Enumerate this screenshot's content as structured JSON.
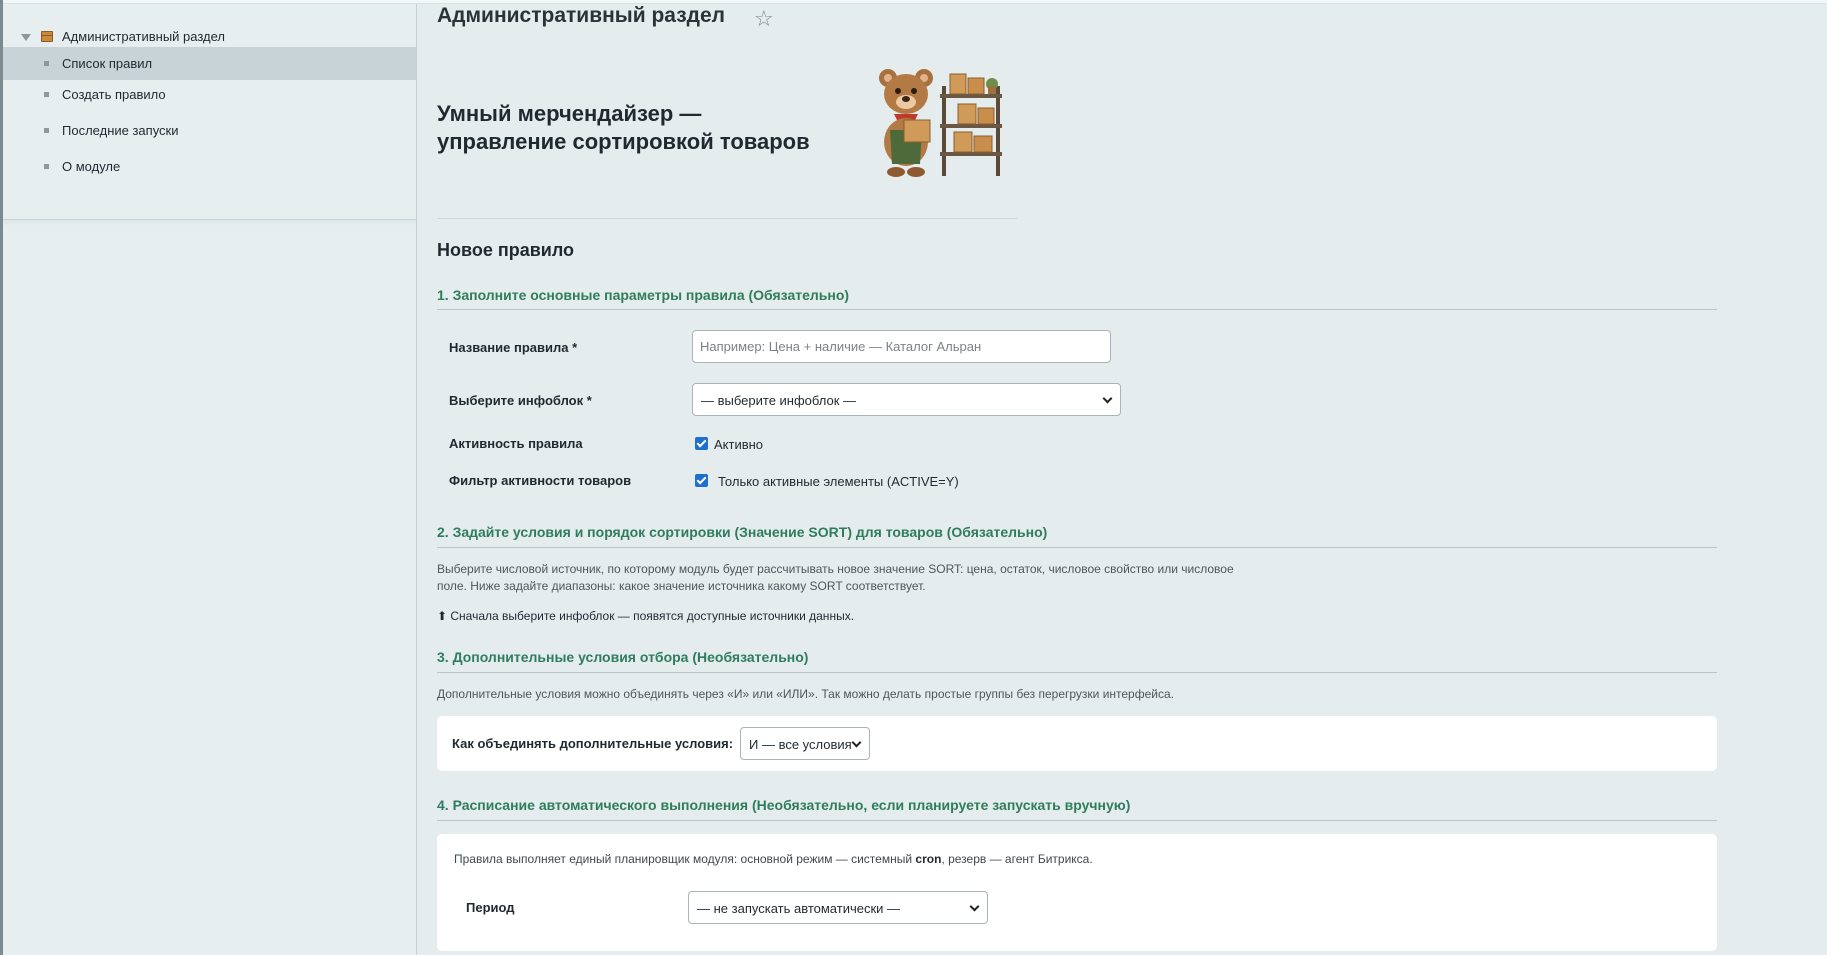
{
  "sidebar": {
    "root_label": "Административный раздел",
    "items": [
      {
        "label": "Список правил",
        "active": true
      },
      {
        "label": "Создать правило",
        "active": false
      },
      {
        "label": "Последние запуски",
        "active": false
      },
      {
        "label": "О модуле",
        "active": false
      }
    ]
  },
  "header": {
    "title": "Административный раздел",
    "hero_title_line1": "Умный мерчендайзер —",
    "hero_title_line2": "управление сортировкой товаров"
  },
  "form": {
    "heading": "Новое правило",
    "section1": {
      "title": "1. Заполните основные параметры правила (Обязательно)",
      "rule_name_label": "Название правила *",
      "rule_name_placeholder": "Например: Цена + наличие — Каталог Альран",
      "rule_name_value": "",
      "iblock_label": "Выберите инфоблок *",
      "iblock_selected": "— выберите инфоблок —",
      "activity_label": "Активность правила",
      "activity_checkbox_label": "Активно",
      "activity_checked": true,
      "filter_label": "Фильтр активности товаров",
      "filter_checkbox_label": "Только активные элементы (ACTIVE=Y)",
      "filter_checked": true
    },
    "section2": {
      "title": "2. Задайте условия и порядок сортировки (Значение SORT) для товаров (Обязательно)",
      "help_line1": "Выберите числовой источник, по которому модуль будет рассчитывать новое значение SORT: цена, остаток, числовое свойство или числовое",
      "help_line2": "поле. Ниже задайте диапазоны: какое значение источника какому SORT соответствует.",
      "note": "⬆ Сначала выберите инфоблок — появятся доступные источники данных."
    },
    "section3": {
      "title": "3. Дополнительные условия отбора (Необязательно)",
      "help": "Дополнительные условия можно объединять через «И» или «ИЛИ». Так можно делать простые группы без перегрузки интерфейса.",
      "combine_label": "Как объединять дополнительные условия:",
      "combine_selected": "И — все условия"
    },
    "section4": {
      "title": "4. Расписание автоматического выполнения (Необязательно, если планируете запускать вручную)",
      "info_prefix": "Правила выполняет единый планировщик модуля: основной режим — системный ",
      "info_cron": "cron",
      "info_suffix": ", резерв — агент Битрикса.",
      "period_label": "Период",
      "period_selected": "— не запускать автоматически —"
    }
  },
  "colors": {
    "section_title": "#2f7d5d",
    "sidebar_active": "#c7d3d7",
    "checkbox": "#1f6fd1",
    "background": "#e4ecee"
  },
  "icons": {
    "favorite": "star-icon",
    "tree_toggle": "caret-down-icon",
    "module": "box-icon",
    "mascot": "bear-mascot-image"
  }
}
